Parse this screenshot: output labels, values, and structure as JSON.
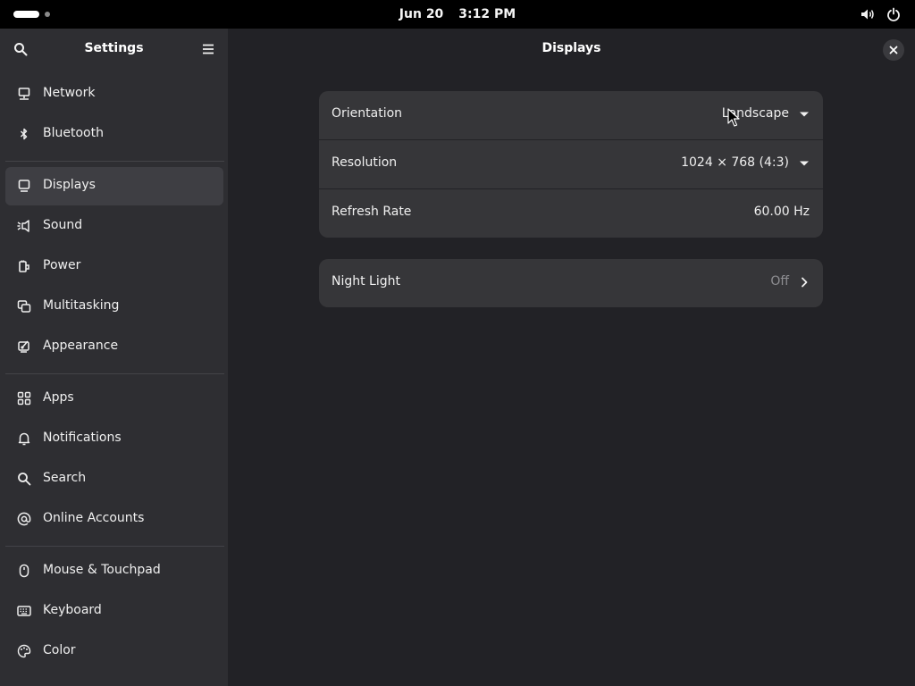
{
  "topbar": {
    "date": "Jun 20",
    "time": "3:12 PM",
    "icons": [
      "workspace-indicator",
      "volume-icon",
      "power-icon"
    ]
  },
  "sidebar": {
    "title": "Settings",
    "search_icon": "search-icon",
    "menu_icon": "hamburger-menu-icon",
    "items": [
      {
        "label": "Network",
        "icon": "network-icon"
      },
      {
        "label": "Bluetooth",
        "icon": "bluetooth-icon"
      },
      {
        "label": "Displays",
        "icon": "display-icon",
        "active": true
      },
      {
        "label": "Sound",
        "icon": "sound-icon"
      },
      {
        "label": "Power",
        "icon": "power-plug-icon"
      },
      {
        "label": "Multitasking",
        "icon": "multitasking-icon"
      },
      {
        "label": "Appearance",
        "icon": "appearance-icon"
      },
      {
        "label": "Apps",
        "icon": "apps-grid-icon"
      },
      {
        "label": "Notifications",
        "icon": "bell-icon"
      },
      {
        "label": "Search",
        "icon": "search-icon"
      },
      {
        "label": "Online Accounts",
        "icon": "at-sign-icon"
      },
      {
        "label": "Mouse & Touchpad",
        "icon": "mouse-icon"
      },
      {
        "label": "Keyboard",
        "icon": "keyboard-icon"
      },
      {
        "label": "Color",
        "icon": "color-palette-icon"
      }
    ]
  },
  "main": {
    "title": "Displays",
    "close_icon": "close-icon",
    "display_settings": [
      {
        "label": "Orientation",
        "value": "Landscape",
        "control": "dropdown"
      },
      {
        "label": "Resolution",
        "value": "1024 × 768 (4:3)",
        "control": "dropdown"
      },
      {
        "label": "Refresh Rate",
        "value": "60.00 Hz",
        "control": "none"
      }
    ],
    "night_light": {
      "label": "Night Light",
      "value": "Off",
      "control": "navigate"
    }
  },
  "colors": {
    "topbar_bg": "#000000",
    "sidebar_bg": "#2e2e32",
    "main_bg": "#222226",
    "card_bg": "#363639",
    "active_item_bg": "#3e3e43"
  }
}
